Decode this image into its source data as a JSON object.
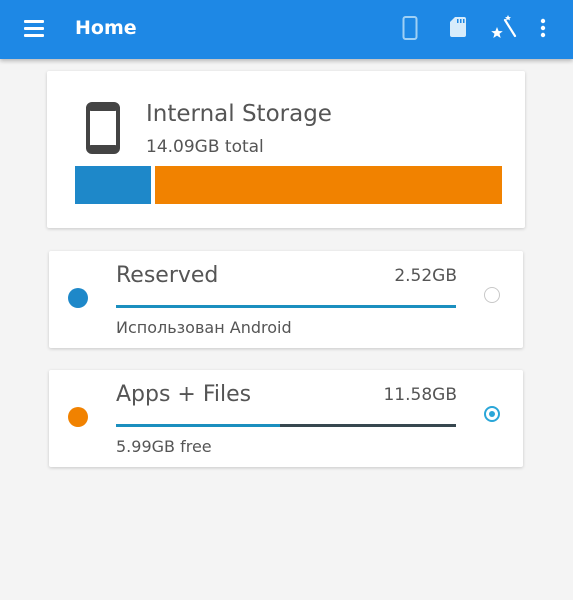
{
  "header": {
    "title": "Home",
    "icons": [
      "menu-icon",
      "phone-icon",
      "sd-card-icon",
      "magic-wand-icon",
      "more-vert-icon"
    ]
  },
  "storage": {
    "title": "Internal Storage",
    "total": "14.09GB total",
    "usage_fraction": {
      "reserved": 0.179,
      "apps_files": 0.821
    }
  },
  "rows": [
    {
      "title": "Reserved",
      "size": "2.52GB",
      "subtitle": "Использован Android",
      "bar_fill": 1.0,
      "selected": false,
      "color": "#1e88c9"
    },
    {
      "title": "Apps + Files",
      "size": "11.58GB",
      "subtitle": "5.99GB free",
      "bar_fill": 0.483,
      "selected": true,
      "color": "#f18200"
    }
  ],
  "colors": {
    "appbar": "#1e88e5",
    "reserved": "#1e88c9",
    "apps_files": "#f18200",
    "accent": "#2aa6d8"
  }
}
